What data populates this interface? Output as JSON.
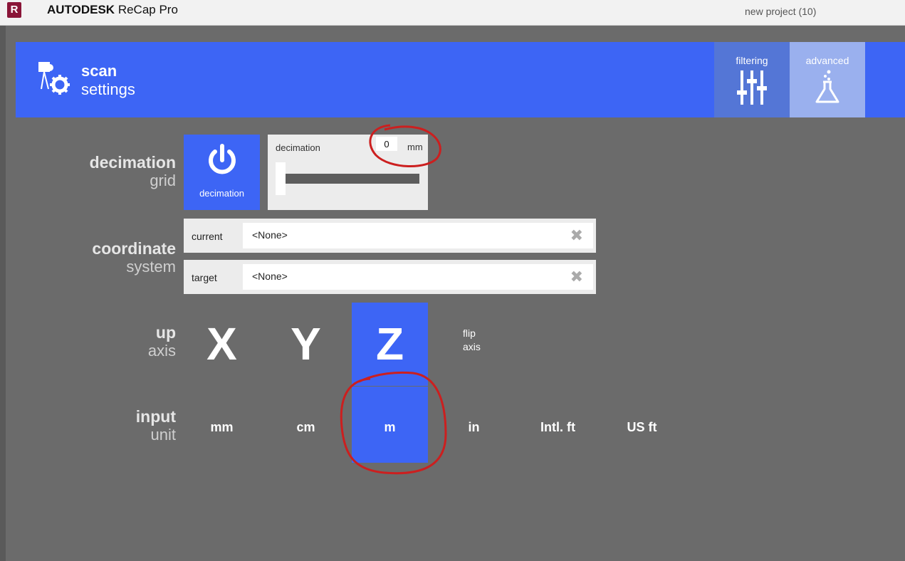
{
  "titlebar": {
    "app_icon_letter": "R",
    "brand": "AUTODESK",
    "product": "ReCap Pro",
    "project": "new project (10)"
  },
  "header": {
    "icon": "scan-settings-icon",
    "title_bold": "scan",
    "title_normal": "settings",
    "tabs": [
      {
        "label": "filtering",
        "icon": "sliders-icon"
      },
      {
        "label": "advanced",
        "icon": "flask-icon"
      }
    ]
  },
  "decimation": {
    "section_bold": "decimation",
    "section_normal": "grid",
    "toggle_label": "decimation",
    "panel_label": "decimation",
    "value": "0",
    "unit": "mm",
    "slider_level": 0
  },
  "coordinate": {
    "section_bold": "coordinate",
    "section_normal": "system",
    "current_label": "current",
    "current_value": "<None>",
    "target_label": "target",
    "target_value": "<None>"
  },
  "up_axis": {
    "section_bold": "up",
    "section_normal": "axis",
    "options": [
      "X",
      "Y",
      "Z"
    ],
    "selected": "Z",
    "flip_line1": "flip",
    "flip_line2": "axis"
  },
  "input_unit": {
    "section_bold": "input",
    "section_normal": "unit",
    "options": [
      "mm",
      "cm",
      "m",
      "in",
      "Intl. ft",
      "US ft"
    ],
    "selected": "m"
  },
  "colors": {
    "accent": "#3d65f5",
    "background": "#6b6b6b",
    "annotation": "#cc1f1f"
  }
}
